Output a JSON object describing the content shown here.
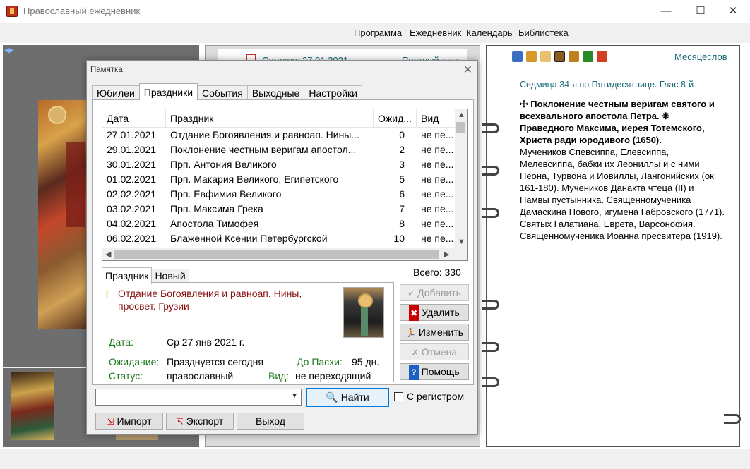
{
  "window": {
    "title": "Православный ежедневник",
    "controls": {
      "minimize": "—",
      "maximize": "☐",
      "close": "✕"
    }
  },
  "menubar": [
    "Программа",
    "Ежедневник",
    "Календарь",
    "Библиотека"
  ],
  "calendar": {
    "today": "Сегодня: 27.01.2021",
    "fast_day": "Постный день"
  },
  "right_page": {
    "months_link": "Месяцеслов",
    "sedmica": "Седмица 34-я по Пятидесятнице. Глас 8-й.",
    "saints_bold_1": "Поклонение честным веригам святого и всехвального апостола Петра.",
    "saints_bold_2": "Праведного Максима, иерея Тотемского, Христа ради юродивого (1650).",
    "saints_text": "Мучеников Спевсиппа, Елевсиппа, Мелевсиппа, бабки их Леониллы и с ними Неона, Турвона и Иовиллы, Лангонийских (ок. 161-180). Мучеников Данакта чтеца (II) и Памвы пустынника. Священномученика Дамаскина Нового, игумена Габровского (1771). Святых Галатиана, Еврета, Варсонофия. Священномученика Иоанна пресвитера (1919)."
  },
  "dialog": {
    "title": "Памятка",
    "close": "✕",
    "tabs": [
      "Юбилеи",
      "Праздники",
      "События",
      "Выходные",
      "Настройки"
    ],
    "active_tab": "Праздники",
    "table": {
      "columns": [
        "Дата",
        "Праздник",
        "Ожид...",
        "Вид"
      ],
      "rows": [
        [
          "27.01.2021",
          "Отдание Богоявления и равноап. Нины...",
          "0",
          "не пе..."
        ],
        [
          "29.01.2021",
          "Поклонение честным веригам апостол...",
          "2",
          "не пе..."
        ],
        [
          "30.01.2021",
          "Прп. Антония Великого",
          "3",
          "не пе..."
        ],
        [
          "01.02.2021",
          "Прп. Макария Великого, Египетского",
          "5",
          "не пе..."
        ],
        [
          "02.02.2021",
          "Прп. Евфимия Великого",
          "6",
          "не пе..."
        ],
        [
          "03.02.2021",
          "Прп. Максима Грека",
          "7",
          "не пе..."
        ],
        [
          "04.02.2021",
          "Апостола Тимофея",
          "8",
          "не пе..."
        ],
        [
          "06.02.2021",
          "Блаженной Ксении Петербургской",
          "10",
          "не пе..."
        ]
      ]
    },
    "subtabs": [
      "Праздник",
      "Новый"
    ],
    "total": "Всего: 330",
    "detail": {
      "name": "Отдание Богоявления и равноап. Нины, просвет. Грузии",
      "date_label": "Дата:",
      "date_value": "Ср 27 янв 2021 г.",
      "wait_label": "Ожидание:",
      "wait_value": "Празднуется сегодня",
      "easter_label": "До Пасхи:",
      "easter_value": "95 дн.",
      "status_label": "Статус:",
      "status_value": "православный",
      "kind_label": "Вид:",
      "kind_value": "не переходящий"
    },
    "buttons": {
      "add": "Добавить",
      "delete": "Удалить",
      "edit": "Изменить",
      "cancel": "Отмена",
      "help": "Помощь",
      "find": "Найти",
      "import": "Импорт",
      "export": "Экспорт",
      "exit": "Выход"
    },
    "search_value": "",
    "case_label": "С регистром",
    "case_checked": false
  }
}
